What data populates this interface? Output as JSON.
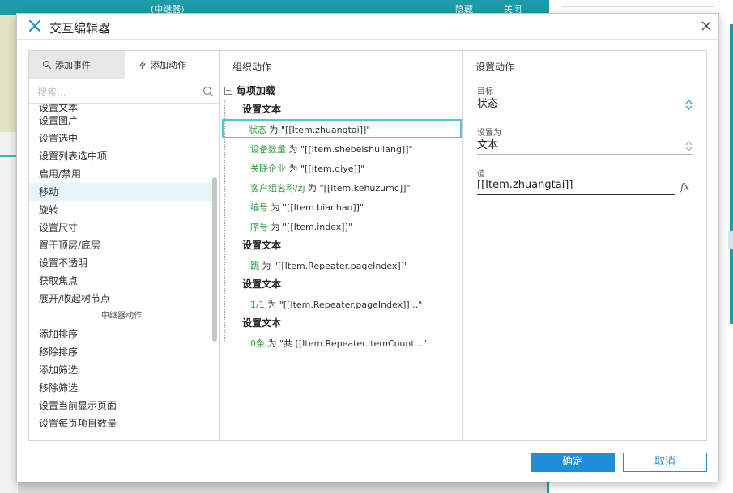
{
  "background": {
    "top_title": "(中继器)",
    "top_hide": "隐藏",
    "top_close": "关闭"
  },
  "dialog": {
    "title": "交互编辑器"
  },
  "left": {
    "tab_add_event": "添加事件",
    "tab_add_action": "添加动作",
    "search_placeholder": "搜索...",
    "items": [
      "设置文本",
      "设置图片",
      "设置选中",
      "设置列表选中项",
      "启用/禁用",
      "移动",
      "旋转",
      "设置尺寸",
      "置于顶层/底层",
      "设置不透明",
      "获取焦点",
      "展开/收起树节点"
    ],
    "group_repeater": "中继器动作",
    "repeater_items": [
      "添加排序",
      "移除排序",
      "添加筛选",
      "移除筛选",
      "设置当前显示页面",
      "设置每页项目数量"
    ]
  },
  "middle": {
    "title": "组织动作",
    "event": "每项加载",
    "actions": [
      {
        "head": "设置文本",
        "rows": [
          {
            "target": "状态",
            "text": " 为 \"[[Item.zhuangtai]]\""
          },
          {
            "target": "设备数量",
            "text": " 为 \"[[Item.shebeishuliang]]\""
          },
          {
            "target": "关联企业",
            "text": " 为 \"[[Item.qiye]]\""
          },
          {
            "target": "客户组名称/zj",
            "text": " 为 \"[[Item.kehuzumc]]\""
          },
          {
            "target": "编号",
            "text": " 为 \"[[Item.bianhao]]\""
          },
          {
            "target": "序号",
            "text": " 为 \"[[Item.index]]\""
          }
        ]
      },
      {
        "head": "设置文本",
        "rows": [
          {
            "target": "跳",
            "text": " 为 \"[[Item.Repeater.pageIndex]]\""
          }
        ]
      },
      {
        "head": "设置文本",
        "rows": [
          {
            "target": "1/1",
            "text": " 为 \"[[Item.Repeater.pageIndex]]...\""
          }
        ]
      },
      {
        "head": "设置文本",
        "rows": [
          {
            "target": "0条",
            "text": " 为 \"共 [[Item.Repeater.itemCount...\""
          }
        ]
      }
    ]
  },
  "right": {
    "title": "设置动作",
    "target_label": "目标",
    "target_value": "状态",
    "setas_label": "设置为",
    "setas_value": "文本",
    "value_label": "值",
    "value_text": "[[Item.zhuangtai]]",
    "fx": "fx"
  },
  "footer": {
    "ok": "确定",
    "cancel": "取消"
  },
  "colors": {
    "accent": "#1e9aa8",
    "primary_button": "#1e8fd6",
    "target_text": "#2e9b3a",
    "selection_border": "#4fc7cf"
  }
}
